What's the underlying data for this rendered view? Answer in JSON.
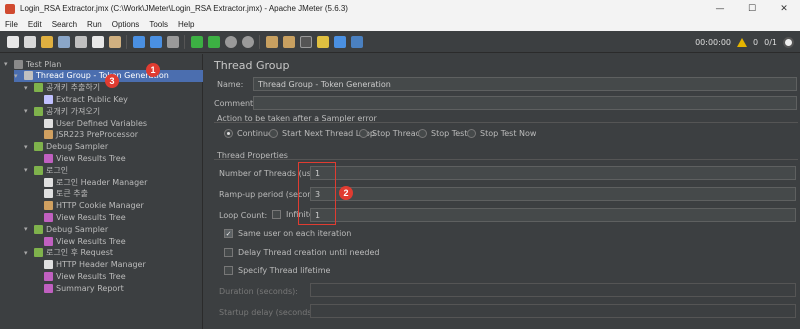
{
  "window": {
    "title": "Login_RSA Extractor.jmx (C:\\Work\\JMeter\\Login_RSA Extractor.jmx) - Apache JMeter (5.6.3)",
    "minimize": "—",
    "maximize": "☐",
    "close": "✕"
  },
  "menu": [
    "File",
    "Edit",
    "Search",
    "Run",
    "Options",
    "Tools",
    "Help"
  ],
  "toolbar_status": {
    "time": "00:00:00",
    "warnings": "0",
    "threads": "0/1"
  },
  "tree": [
    {
      "label": "Test Plan",
      "icon": "test-plan-icon",
      "color": "#8a8a8a"
    },
    {
      "label": "Thread Group - Token Generation",
      "icon": "gear-icon",
      "color": "#c0c0c0"
    },
    {
      "label": "공개키 추출하기",
      "icon": "sampler-icon",
      "color": "#7fb24c"
    },
    {
      "label": "Extract Public Key",
      "icon": "extractor-icon",
      "color": "#c0c0ff"
    },
    {
      "label": "공개키 가져오기",
      "icon": "sampler-icon",
      "color": "#7fb24c"
    },
    {
      "label": "User Defined Variables",
      "icon": "config-icon",
      "color": "#e0e0e0"
    },
    {
      "label": "JSR223 PreProcessor",
      "icon": "preprocessor-icon",
      "color": "#d0a060"
    },
    {
      "label": "Debug Sampler",
      "icon": "sampler-icon",
      "color": "#7fb24c"
    },
    {
      "label": "View Results Tree",
      "icon": "listener-icon",
      "color": "#c060c0"
    },
    {
      "label": "로그인",
      "icon": "sampler-icon",
      "color": "#7fb24c"
    },
    {
      "label": "로그인 Header Manager",
      "icon": "config-icon",
      "color": "#e0e0e0"
    },
    {
      "label": "토큰 추출",
      "icon": "extractor-icon",
      "color": "#e0e0e0"
    },
    {
      "label": "HTTP Cookie Manager",
      "icon": "cookie-icon",
      "color": "#d0a060"
    },
    {
      "label": "View Results Tree",
      "icon": "listener-icon",
      "color": "#c060c0"
    },
    {
      "label": "Debug Sampler",
      "icon": "sampler-icon",
      "color": "#7fb24c"
    },
    {
      "label": "View Results Tree",
      "icon": "listener-icon",
      "color": "#c060c0"
    },
    {
      "label": "로그인 후 Request",
      "icon": "sampler-icon",
      "color": "#7fb24c"
    },
    {
      "label": "HTTP Header Manager",
      "icon": "config-icon",
      "color": "#e0e0e0"
    },
    {
      "label": "View Results Tree",
      "icon": "listener-icon",
      "color": "#c060c0"
    },
    {
      "label": "Summary Report",
      "icon": "listener-icon",
      "color": "#c060c0"
    }
  ],
  "panel": {
    "title": "Thread Group",
    "name_label": "Name:",
    "name_value": "Thread Group - Token Generation",
    "comments_label": "Comments:",
    "comments_value": "",
    "error_action_label": "Action to be taken after a Sampler error",
    "error_actions": [
      "Continue",
      "Start Next Thread Loop",
      "Stop Thread",
      "Stop Test",
      "Stop Test Now"
    ],
    "thread_props_label": "Thread Properties",
    "num_threads_label": "Number of Threads (users):",
    "num_threads_value": "1",
    "rampup_label": "Ramp-up period (seconds):",
    "rampup_value": "3",
    "loop_label": "Loop Count:",
    "infinite_label": "Infinite",
    "loop_value": "1",
    "same_user_label": "Same user on each iteration",
    "delay_label": "Delay Thread creation until needed",
    "lifetime_label": "Specify Thread lifetime",
    "duration_label": "Duration (seconds):",
    "startup_label": "Startup delay (seconds):"
  },
  "annotations": [
    "1",
    "2",
    "3"
  ],
  "colors": {
    "selection": "#4b6eaf",
    "annotation": "#e03c31",
    "background": "#3c3f41"
  }
}
